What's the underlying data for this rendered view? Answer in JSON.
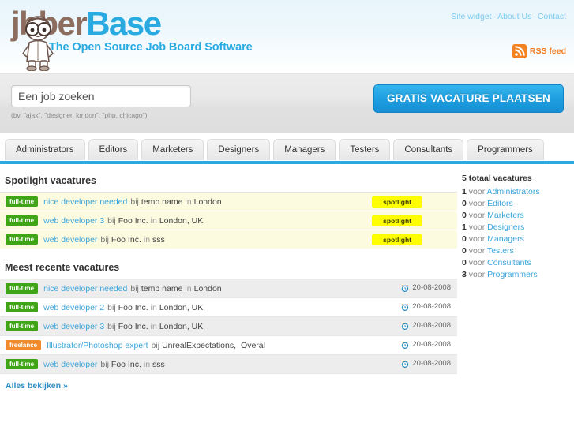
{
  "header": {
    "logo": {
      "part1": "j",
      "part2": "bber",
      "part3": "Base",
      "mascot_icon": "mascot-icon"
    },
    "tagline": "The Open Source Job Board Software",
    "topnav": [
      {
        "label": "Site widget"
      },
      {
        "label": "About Us"
      },
      {
        "label": "Contact"
      }
    ],
    "topnav_separator": "·",
    "rss": {
      "label": "RSS feed",
      "icon": "rss-icon"
    }
  },
  "search": {
    "value": "Een job zoeken",
    "placeholder": "Een job zoeken",
    "hint": "(bv. \"ajax\", \"designer, london\", \"php, chicago\")",
    "post_button": "GRATIS VACATURE PLAATSEN"
  },
  "tabs": [
    {
      "label": "Administrators"
    },
    {
      "label": "Editors"
    },
    {
      "label": "Marketers"
    },
    {
      "label": "Designers"
    },
    {
      "label": "Managers"
    },
    {
      "label": "Testers"
    },
    {
      "label": "Consultants"
    },
    {
      "label": "Programmers"
    }
  ],
  "spotlight": {
    "title": "Spotlight vacatures",
    "tag": "spotlight",
    "jobs": [
      {
        "type": "full-time",
        "title": "nice developer needed",
        "by": "bij",
        "company": "temp name",
        "in": "in",
        "location": "London"
      },
      {
        "type": "full-time",
        "title": "web developer 3",
        "by": "bij",
        "company": "Foo Inc.",
        "in": "in",
        "location": "London, UK"
      },
      {
        "type": "full-time",
        "title": "web developer",
        "by": "bij",
        "company": "Foo Inc.",
        "in": "in",
        "location": "sss"
      }
    ]
  },
  "recent": {
    "title": "Meest recente vacatures",
    "all_link": "Alles bekijken »",
    "clock_icon": "clock-icon",
    "jobs": [
      {
        "type": "full-time",
        "title": "nice developer needed",
        "by": "bij",
        "company": "temp name",
        "in": "in",
        "location": "London",
        "date": "20-08-2008"
      },
      {
        "type": "full-time",
        "title": "web developer 2",
        "by": "bij",
        "company": "Foo Inc.",
        "in": "in",
        "location": "London, UK",
        "date": "20-08-2008"
      },
      {
        "type": "full-time",
        "title": "web developer 3",
        "by": "bij",
        "company": "Foo Inc.",
        "in": "in",
        "location": "London, UK",
        "date": "20-08-2008"
      },
      {
        "type": "freelance",
        "title": "Illustrator/Photoshop expert",
        "by": "bij",
        "company": "UnrealExpectations,",
        "in": "",
        "location": "Overal",
        "date": "20-08-2008"
      },
      {
        "type": "full-time",
        "title": "web developer",
        "by": "bij",
        "company": "Foo Inc.",
        "in": "in",
        "location": "sss",
        "date": "20-08-2008"
      }
    ]
  },
  "sidebar": {
    "total": "5 totaal vacatures",
    "voor": "voor",
    "counts": [
      {
        "count": "1",
        "label": "Administrators"
      },
      {
        "count": "0",
        "label": "Editors"
      },
      {
        "count": "0",
        "label": "Marketers"
      },
      {
        "count": "1",
        "label": "Designers"
      },
      {
        "count": "0",
        "label": "Managers"
      },
      {
        "count": "0",
        "label": "Testers"
      },
      {
        "count": "0",
        "label": "Consultants"
      },
      {
        "count": "3",
        "label": "Programmers"
      }
    ]
  },
  "colors": {
    "brand_blue": "#29abe2",
    "logo_brown": "#8c6d5e",
    "fulltime_green": "#3fa416",
    "freelance_orange": "#f08a2a",
    "spotlight_yellow": "#ffff00",
    "rss_orange": "#f07b22"
  }
}
